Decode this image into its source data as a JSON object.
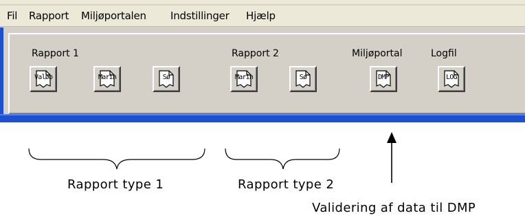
{
  "menu": {
    "items": [
      {
        "label": "Fil"
      },
      {
        "label": "Rapport"
      },
      {
        "label": "Miljøportalen"
      },
      {
        "label": "Indstillinger"
      },
      {
        "label": "Hjælp"
      }
    ]
  },
  "toolbar": {
    "groups": {
      "rapport1": "Rapport 1",
      "rapport2": "Rapport 2",
      "miljoportal": "Miljøportal",
      "logfil": "Logfil"
    },
    "buttons": {
      "valob": "Valøb",
      "marin1": "Marin",
      "so1": "Sø",
      "marin2": "Marin",
      "so2": "Sø",
      "dmp": "DMP",
      "log": "LOG"
    }
  },
  "annotations": {
    "type1": "Rapport type 1",
    "type2": "Rapport type 2",
    "dmp": "Validering af data til DMP"
  },
  "colors": {
    "window_bg": "#d4d0c8",
    "menubar_bg": "#ece9d8",
    "title_blue": "#1e4fd0"
  },
  "icons": {
    "button_icon": "document-page-icon",
    "arrow": "up-arrow"
  }
}
